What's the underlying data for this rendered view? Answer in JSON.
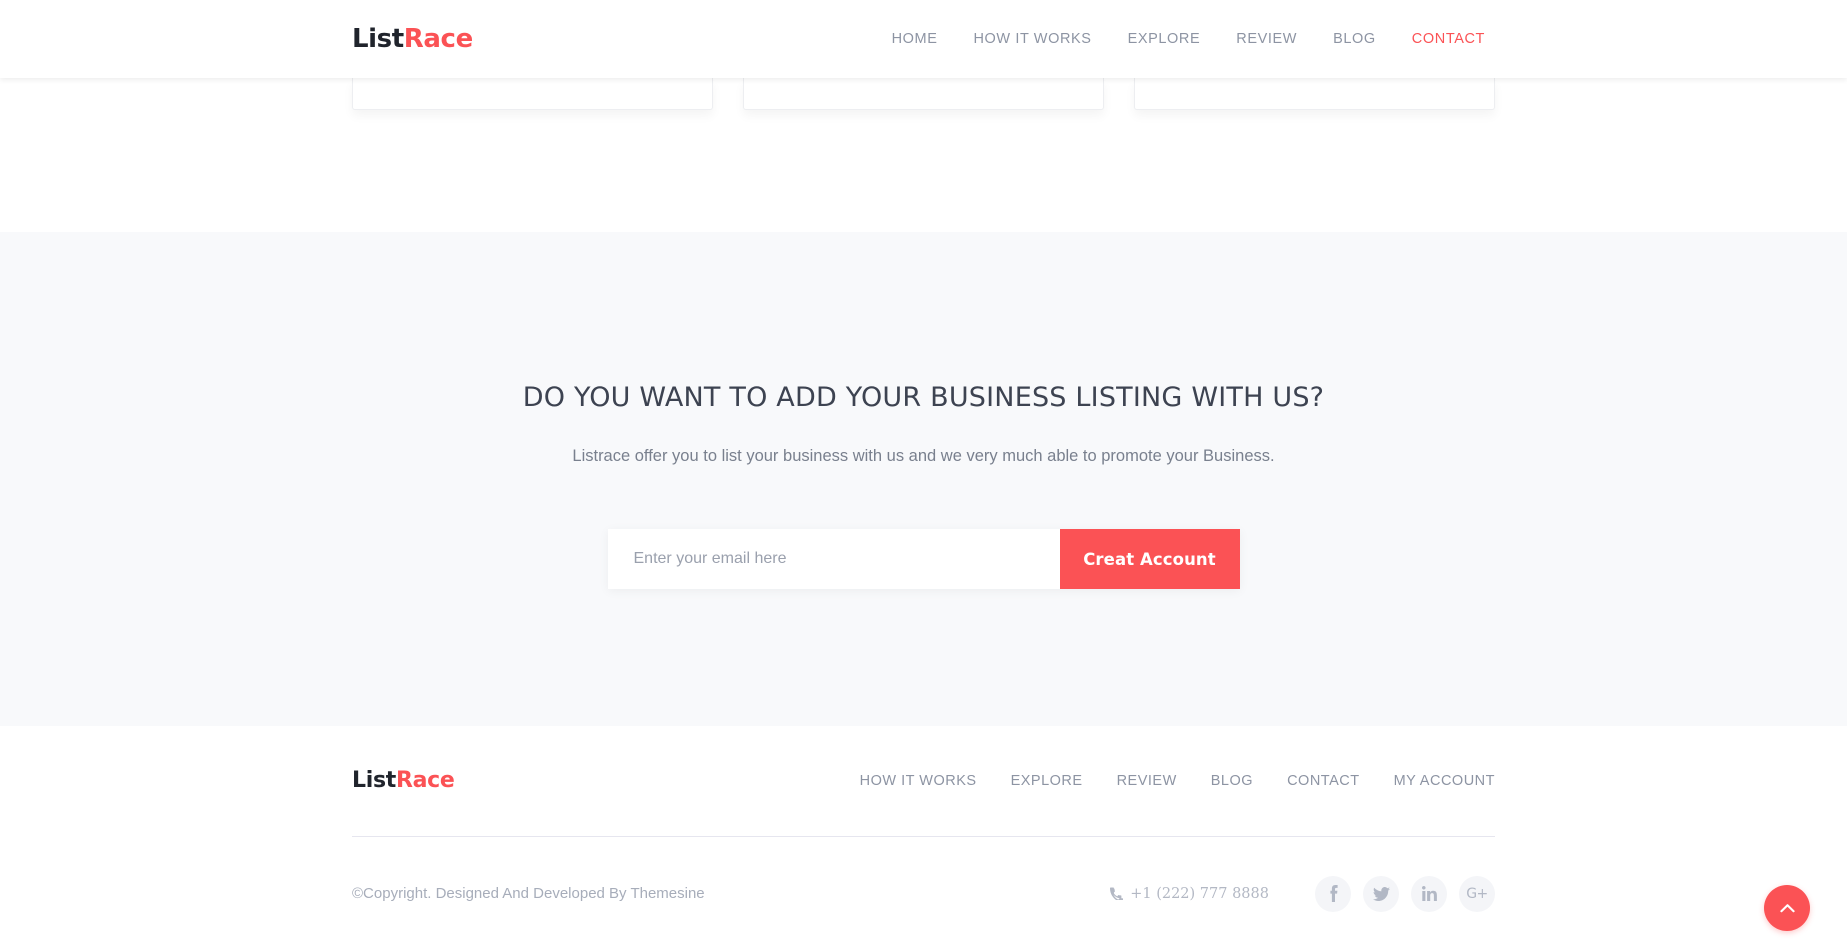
{
  "brand": {
    "name_part1": "List",
    "name_part2": "Race",
    "accent_color": "#fb5255",
    "text_color": "#20242c",
    "muted_color": "#8d94a3",
    "section_bg": "#f8f9fb"
  },
  "header": {
    "nav": [
      {
        "label": "HOME",
        "active": false
      },
      {
        "label": "HOW IT WORKS",
        "active": false
      },
      {
        "label": "EXPLORE",
        "active": false
      },
      {
        "label": "REVIEW",
        "active": false
      },
      {
        "label": "BLOG",
        "active": false
      },
      {
        "label": "CONTACT",
        "active": true
      }
    ]
  },
  "cards_strip": {
    "card_count": 3,
    "note": "bottom edges of three listing cards, clipped by scroll position"
  },
  "cta": {
    "title": "DO YOU WANT TO ADD YOUR BUSINESS LISTING WITH US?",
    "subtitle": "Listrace offer you to list your business with us and we very much able to promote your Business.",
    "email_placeholder": "Enter your email here",
    "email_value": "",
    "button_label": "Creat Account"
  },
  "footer": {
    "nav": [
      {
        "label": "HOW IT WORKS"
      },
      {
        "label": "EXPLORE"
      },
      {
        "label": "REVIEW"
      },
      {
        "label": "BLOG"
      },
      {
        "label": "CONTACT"
      },
      {
        "label": "MY ACCOUNT"
      }
    ],
    "copyright": "©Copyright. Designed And Developed By Themesine",
    "phone": "+1 (222) 777 8888",
    "phone_icon": "phone-icon",
    "socials": [
      {
        "name": "facebook",
        "icon": "facebook-icon"
      },
      {
        "name": "twitter",
        "icon": "twitter-icon"
      },
      {
        "name": "linkedin",
        "icon": "linkedin-icon"
      },
      {
        "name": "googleplus",
        "icon": "google-plus-icon",
        "text": "G+"
      }
    ]
  },
  "scroll_top": {
    "icon": "chevron-up-icon",
    "aria": "Back to top"
  }
}
